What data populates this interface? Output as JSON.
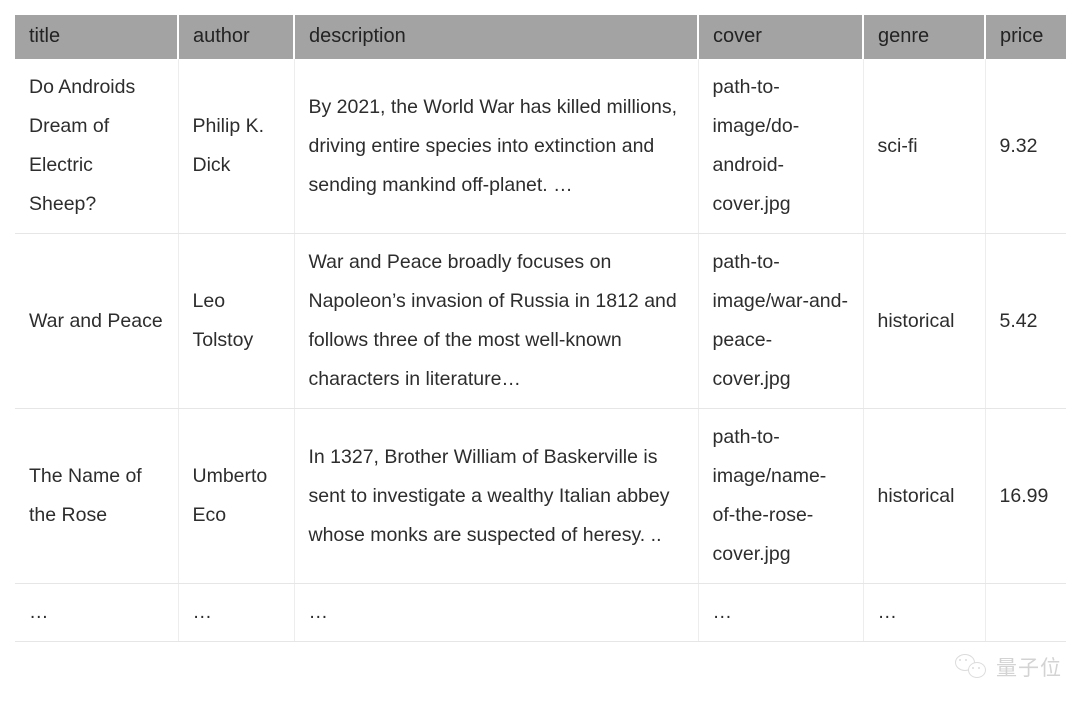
{
  "table": {
    "columns": [
      {
        "key": "title",
        "label": "title"
      },
      {
        "key": "author",
        "label": "author"
      },
      {
        "key": "description",
        "label": "description"
      },
      {
        "key": "cover",
        "label": "cover"
      },
      {
        "key": "genre",
        "label": "genre"
      },
      {
        "key": "price",
        "label": "price"
      }
    ],
    "rows": [
      {
        "title": "Do Androids Dream of Electric Sheep?",
        "author": "Philip K. Dick",
        "description": "By 2021, the World War has killed millions, driving entire species into extinction and sending mankind off-planet. …",
        "cover": "path-to-image/do-android-cover.jpg",
        "genre": "sci-fi",
        "price": "9.32"
      },
      {
        "title": "War and Peace",
        "author": "Leo Tolstoy",
        "description": "War and Peace broadly focuses on Napoleon’s invasion of Russia in 1812 and follows three of the most well-known characters in literature…",
        "cover": "path-to-image/war-and-peace-cover.jpg",
        "genre": "historical",
        "price": "5.42"
      },
      {
        "title": "The Name of the Rose",
        "author": "Umberto Eco",
        "description": "In 1327, Brother William of Baskerville is sent to investigate a wealthy Italian abbey whose monks are suspected of heresy. ..",
        "cover": "path-to-image/name-of-the-rose-cover.jpg",
        "genre": "historical",
        "price": "16.99"
      },
      {
        "title": "…",
        "author": "…",
        "description": "…",
        "cover": "…",
        "genre": "…",
        "price": ""
      }
    ]
  },
  "watermark": {
    "text": "量子位",
    "icon": "wechat-bubbles-icon"
  },
  "colors": {
    "header_background": "#a3a3a3",
    "header_text": "#232323",
    "body_text": "#2d2d2d",
    "row_border": "#e6e6e6",
    "page_background": "#ffffff"
  }
}
